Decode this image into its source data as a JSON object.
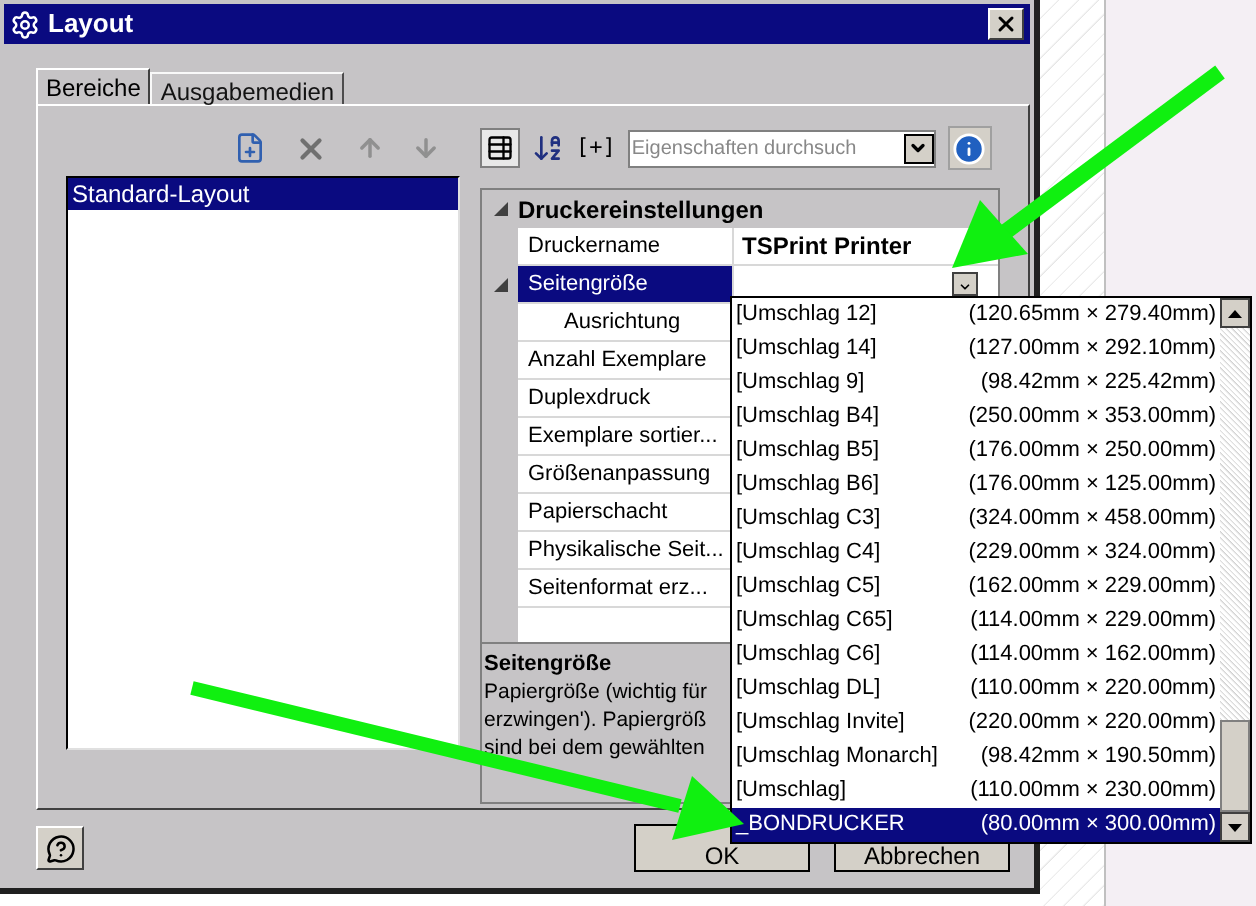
{
  "window": {
    "title": "Layout"
  },
  "tabs": [
    {
      "label": "Bereiche",
      "selected": true
    },
    {
      "label": "Ausgabemedien",
      "selected": false
    }
  ],
  "layout_list": {
    "items": [
      {
        "label": "Standard-Layout",
        "selected": true
      }
    ]
  },
  "property_toolbar": {
    "categorized_pressed": true,
    "expand_label": "[+]",
    "search": {
      "placeholder": "Eigenschaften durchsuch"
    }
  },
  "property_grid": {
    "category": {
      "label": "Druckereinstellungen",
      "expanded": true
    },
    "rows": [
      {
        "name": "Druckername",
        "value": "TSPrint Printer",
        "selected": false
      },
      {
        "name": "Seitengröße",
        "selected": true,
        "expanded": true,
        "children": [
          {
            "name": "Ausrichtung",
            "selected": false
          }
        ]
      },
      {
        "name": "Anzahl Exemplare",
        "selected": false
      },
      {
        "name": "Duplexdruck",
        "selected": false
      },
      {
        "name": "Exemplare sortier...",
        "selected": false
      },
      {
        "name": "Größenanpassung",
        "selected": false
      },
      {
        "name": "Papierschacht",
        "selected": false
      },
      {
        "name": "Physikalische Seit...",
        "selected": false
      },
      {
        "name": "Seitenformat erz...",
        "selected": false
      }
    ]
  },
  "description": {
    "title": "Seitengröße",
    "lines": [
      "Papiergröße (wichtig für",
      "erzwingen'). Papiergröß",
      "sind bei dem gewählten"
    ]
  },
  "dropdown": {
    "items": [
      {
        "label": "[Umschlag 12]",
        "size": "(120.65mm × 279.40mm)",
        "selected": false
      },
      {
        "label": "[Umschlag 14]",
        "size": "(127.00mm × 292.10mm)",
        "selected": false
      },
      {
        "label": "[Umschlag 9]",
        "size": "(98.42mm × 225.42mm)",
        "selected": false
      },
      {
        "label": "[Umschlag B4]",
        "size": "(250.00mm × 353.00mm)",
        "selected": false
      },
      {
        "label": "[Umschlag B5]",
        "size": "(176.00mm × 250.00mm)",
        "selected": false
      },
      {
        "label": "[Umschlag B6]",
        "size": "(176.00mm × 125.00mm)",
        "selected": false
      },
      {
        "label": "[Umschlag C3]",
        "size": "(324.00mm × 458.00mm)",
        "selected": false
      },
      {
        "label": "[Umschlag C4]",
        "size": "(229.00mm × 324.00mm)",
        "selected": false
      },
      {
        "label": "[Umschlag C5]",
        "size": "(162.00mm × 229.00mm)",
        "selected": false
      },
      {
        "label": "[Umschlag C65]",
        "size": "(114.00mm × 229.00mm)",
        "selected": false
      },
      {
        "label": "[Umschlag C6]",
        "size": "(114.00mm × 162.00mm)",
        "selected": false
      },
      {
        "label": "[Umschlag DL]",
        "size": "(110.00mm × 220.00mm)",
        "selected": false
      },
      {
        "label": "[Umschlag Invite]",
        "size": "(220.00mm × 220.00mm)",
        "selected": false
      },
      {
        "label": "[Umschlag Monarch]",
        "size": "(98.42mm × 190.50mm)",
        "selected": false
      },
      {
        "label": "[Umschlag]",
        "size": "(110.00mm × 230.00mm)",
        "selected": false
      },
      {
        "label": "_BONDRUCKER",
        "size": "(80.00mm × 300.00mm)",
        "selected": true
      }
    ]
  },
  "buttons": {
    "ok": "OK",
    "cancel": "Abbrechen"
  }
}
